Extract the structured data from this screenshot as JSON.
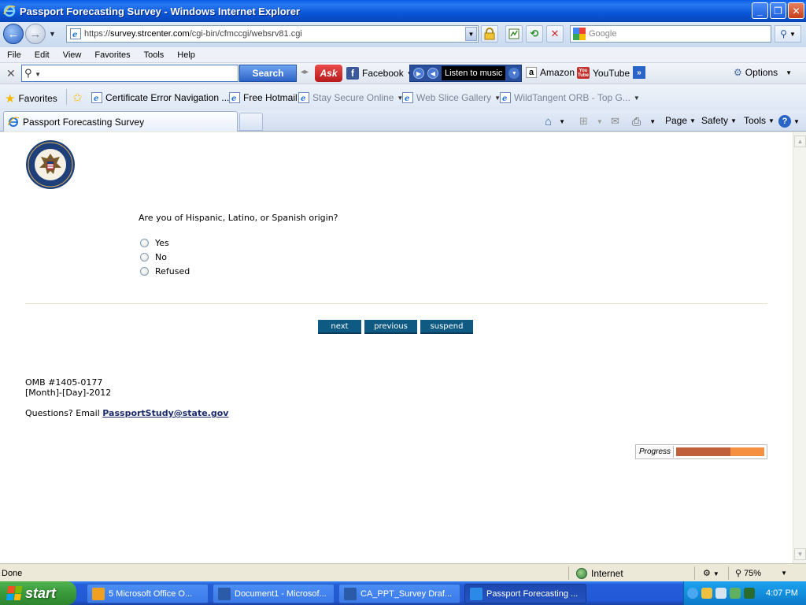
{
  "window": {
    "title": "Passport Forecasting Survey - Windows Internet Explorer",
    "buttons": [
      "minimize",
      "restore",
      "close"
    ]
  },
  "address_bar": {
    "url_prefix": "https://",
    "url_host": "survey.strcenter.com",
    "url_path": "/cgi-bin/cfmccgi/websrv81.cgi",
    "search_placeholder": "Google"
  },
  "menu": [
    "File",
    "Edit",
    "View",
    "Favorites",
    "Tools",
    "Help"
  ],
  "ask_toolbar": {
    "search_button": "Search",
    "ask_logo": "Ask",
    "facebook": "Facebook",
    "music": "Listen to music",
    "amazon": "Amazon",
    "youtube": "YouTube",
    "options": "Options"
  },
  "favorites_bar": {
    "favorites_label": "Favorites",
    "items": [
      {
        "label": "Certificate Error Navigation ...",
        "dim": false
      },
      {
        "label": "Free Hotmail",
        "dim": false
      },
      {
        "label": "Stay Secure Online",
        "dim": true
      },
      {
        "label": "Web Slice Gallery",
        "dim": true
      },
      {
        "label": "WildTangent ORB - Top G...",
        "dim": true
      }
    ]
  },
  "tab": {
    "title": "Passport Forecasting Survey"
  },
  "command_bar": {
    "page": "Page",
    "safety": "Safety",
    "tools": "Tools"
  },
  "survey": {
    "question": "Are you of Hispanic, Latino, or Spanish origin?",
    "options": [
      "Yes",
      "No",
      "Refused"
    ],
    "selected": null,
    "buttons": {
      "next": "next",
      "previous": "previous",
      "suspend": "suspend"
    },
    "omb": "OMB #1405-0177",
    "date": "[Month]-[Day]-2012",
    "questions_prefix": "Questions? Email ",
    "email": "PassportStudy@state.gov",
    "progress_label": "Progress",
    "progress_fraction": 0.62,
    "progress_fill_color": "#c0603a",
    "progress_track_color": "#f59040",
    "button_color": "#0e5a82"
  },
  "status_bar": {
    "status": "Done",
    "zone": "Internet",
    "zoom": "75%"
  },
  "taskbar": {
    "start": "start",
    "items": [
      {
        "label": "5 Microsoft Office O...",
        "active": false
      },
      {
        "label": "Document1 - Microsof...",
        "active": false
      },
      {
        "label": "CA_PPT_Survey Draf...",
        "active": false
      },
      {
        "label": "Passport Forecasting ...",
        "active": true
      }
    ],
    "clock": "4:07 PM"
  }
}
